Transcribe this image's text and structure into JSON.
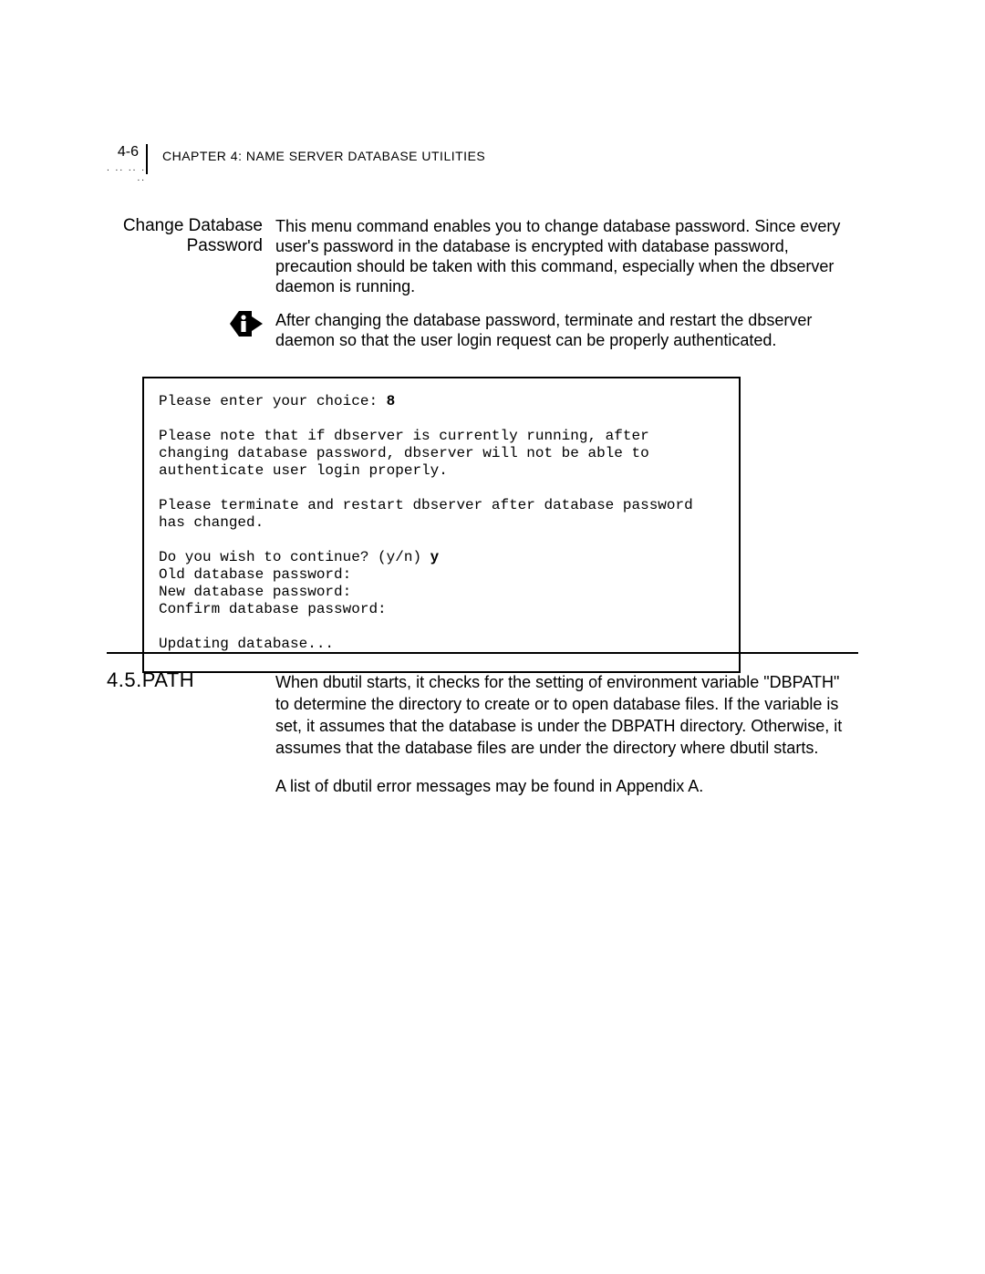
{
  "header": {
    "page_num": "4-6",
    "chapter_label": "CHAPTER 4: NAME SERVER DATABASE UTILITIES",
    "dots": ". .. .. . .."
  },
  "section1": {
    "left_title_line1": "Change Database",
    "left_title_line2": "Password",
    "body": "This menu command enables you to change database password. Since every user's password in the database is encrypted with database password, precaution should be taken with this command, especially when the dbserver daemon is running.",
    "note": "After changing the database password, terminate and restart the dbserver daemon so that the user login request can be properly authenticated."
  },
  "codebox": {
    "l1a": "Please enter your choice: ",
    "l1b": "8",
    "blk2": "Please note that if dbserver is currently running, after changing database password, dbserver will not be able to authenticate user login properly.",
    "blk3": "Please terminate and restart dbserver after database password has changed.",
    "l4a": "Do you wish to continue? (y/n) ",
    "l4b": "y",
    "l5": "Old database password:",
    "l6": "New database password:",
    "l7": "Confirm database password:",
    "l8": "Updating database..."
  },
  "section2": {
    "title": "4.5.PATH",
    "p1": "When dbutil starts, it checks for the setting of environment variable \"DBPATH\" to determine the directory to create or to open database files. If the variable is set, it assumes that the database is under the DBPATH directory. Otherwise, it assumes that the database files are under the directory where dbutil starts.",
    "p2": "A list of dbutil error messages may be found in Appendix A."
  }
}
